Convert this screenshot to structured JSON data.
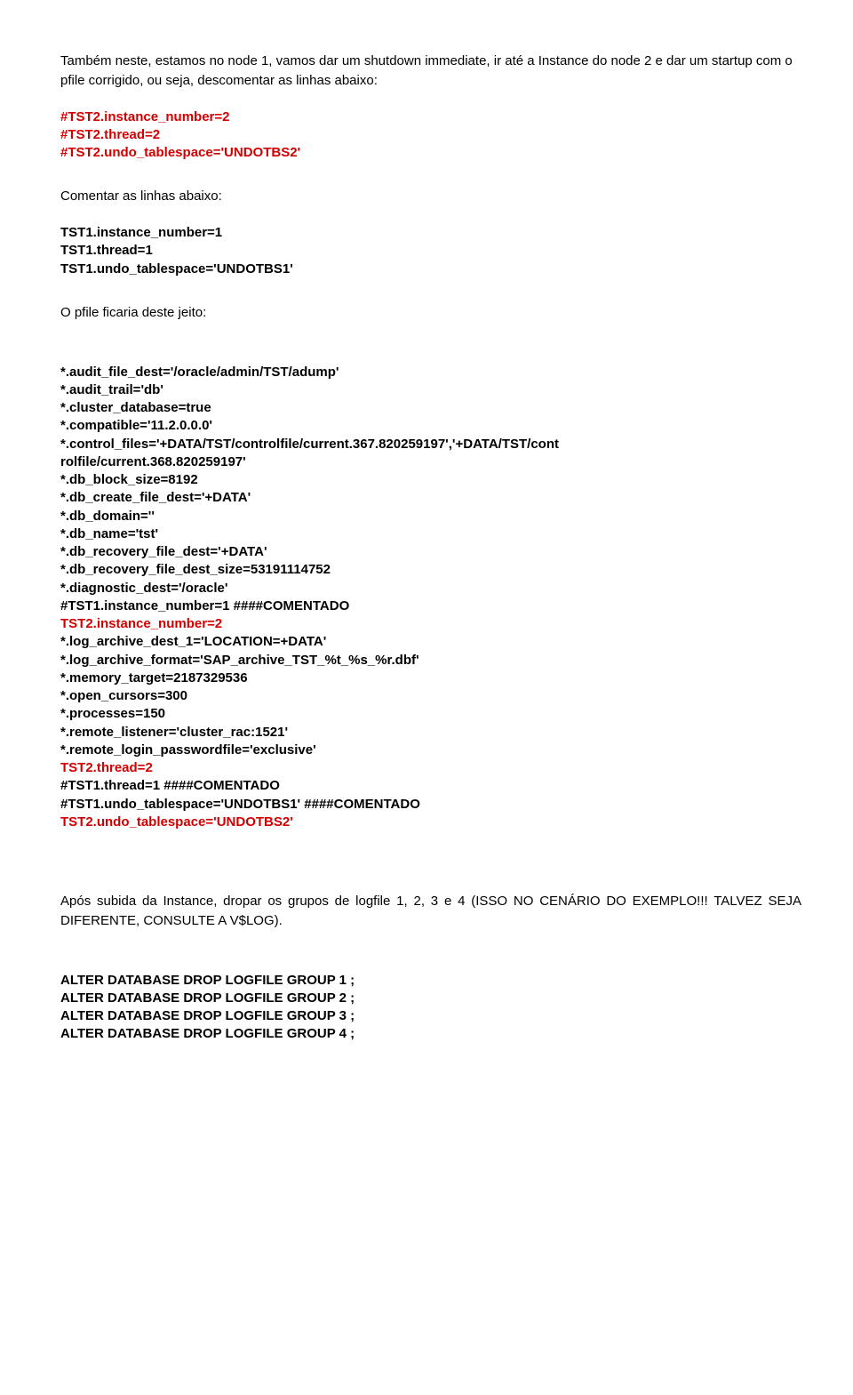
{
  "p1": "Também neste, estamos no node 1, vamos dar um shutdown immediate, ir até a Instance do node 2 e dar um startup com o pfile corrigido, ou seja, descomentar as linhas abaixo:",
  "uncomment": {
    "l1": "#TST2.instance_number=2",
    "l2": "#TST2.thread=2",
    "l3": "#TST2.undo_tablespace='UNDOTBS2'"
  },
  "p2": "Comentar as linhas abaixo:",
  "comment": {
    "l1": "TST1.instance_number=1",
    "l2": "TST1.thread=1",
    "l3": "TST1.undo_tablespace='UNDOTBS1'"
  },
  "p3": "O pfile ficaria deste jeito:",
  "pfile": {
    "l1": "*.audit_file_dest='/oracle/admin/TST/adump'",
    "l2": "*.audit_trail='db'",
    "l3": "*.cluster_database=true",
    "l4": "*.compatible='11.2.0.0.0'",
    "l5": "*.control_files='+DATA/TST/controlfile/current.367.820259197','+DATA/TST/cont",
    "l5b": "rolfile/current.368.820259197'",
    "l6": "*.db_block_size=8192",
    "l7": "*.db_create_file_dest='+DATA'",
    "l8": "*.db_domain=''",
    "l9": "*.db_name='tst'",
    "l10": "*.db_recovery_file_dest='+DATA'",
    "l11": "*.db_recovery_file_dest_size=53191114752",
    "l12": "*.diagnostic_dest='/oracle'",
    "l13": "#TST1.instance_number=1   ####COMENTADO",
    "l14": "TST2.instance_number=2",
    "l15": "*.log_archive_dest_1='LOCATION=+DATA'",
    "l16": "*.log_archive_format='SAP_archive_TST_%t_%s_%r.dbf'",
    "l17": "*.memory_target=2187329536",
    "l18": "*.open_cursors=300",
    "l19": "*.processes=150",
    "l20": "*.remote_listener='cluster_rac:1521'",
    "l21": "*.remote_login_passwordfile='exclusive'",
    "l22": "TST2.thread=2",
    "l23": "#TST1.thread=1                    ####COMENTADO",
    "l24": "#TST1.undo_tablespace='UNDOTBS1'      ####COMENTADO",
    "l25": "TST2.undo_tablespace='UNDOTBS2'"
  },
  "p4": "Após subida da Instance, dropar os grupos de logfile 1, 2, 3 e 4 (ISSO NO CENÁRIO DO EXEMPLO!!! TALVEZ SEJA DIFERENTE, CONSULTE A V$LOG).",
  "alter": {
    "l1": "ALTER DATABASE DROP LOGFILE GROUP 1 ;",
    "l2": "ALTER DATABASE DROP LOGFILE GROUP 2 ;",
    "l3": "ALTER DATABASE DROP LOGFILE GROUP 3 ;",
    "l4": "ALTER DATABASE DROP LOGFILE GROUP 4 ;"
  }
}
